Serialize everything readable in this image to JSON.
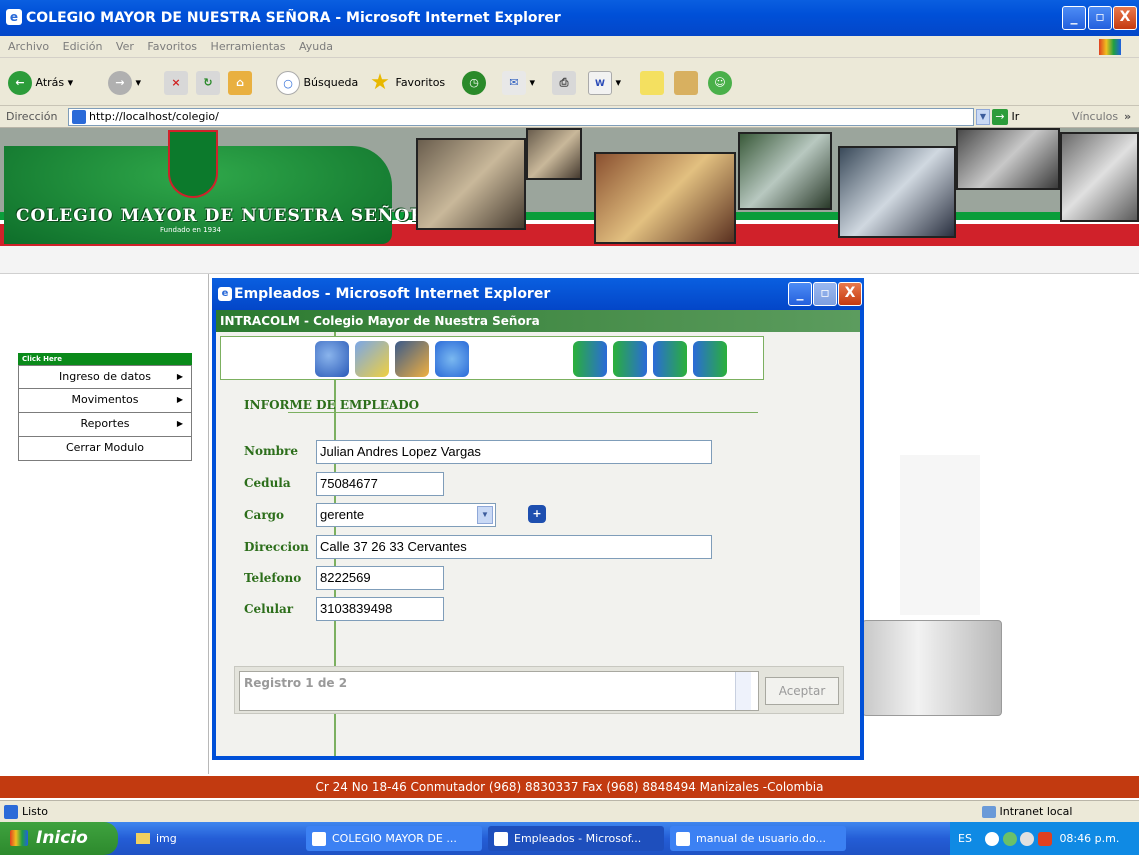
{
  "window": {
    "title": "COLEGIO MAYOR DE NUESTRA SEÑORA - Microsoft Internet Explorer",
    "minimize": "_",
    "maximize": "▫",
    "close": "X"
  },
  "menu": [
    "Archivo",
    "Edición",
    "Ver",
    "Favoritos",
    "Herramientas",
    "Ayuda"
  ],
  "toolbar": {
    "back": "Atrás",
    "search": "Búsqueda",
    "favorites": "Favoritos"
  },
  "address": {
    "label": "Dirección",
    "url": "http://localhost/colegio/",
    "go": "Ir",
    "links": "Vínculos"
  },
  "banner": {
    "name": "COLEGIO MAYOR DE NUESTRA SEÑORA",
    "founded": "Fundado en 1934"
  },
  "sidemenu": {
    "header": "Click Here",
    "items": [
      {
        "label": "Ingreso de datos",
        "arrow": "▶"
      },
      {
        "label": "Movimentos",
        "arrow": "▶"
      },
      {
        "label": "Reportes",
        "arrow": "▶"
      },
      {
        "label": "Cerrar Modulo",
        "arrow": ""
      }
    ]
  },
  "popup": {
    "title": "Empleados - Microsoft Internet Explorer",
    "header": "INTRACOLM - Colegio Mayor de Nuestra Señora",
    "section": "INFORME DE EMPLEADO",
    "fields": {
      "nombre_label": "Nombre",
      "nombre": "Julian Andres Lopez Vargas",
      "cedula_label": "Cedula",
      "cedula": "75084677",
      "cargo_label": "Cargo",
      "cargo": "gerente",
      "direccion_label": "Direccion",
      "direccion": "Calle 37 26 33 Cervantes",
      "telefono_label": "Telefono",
      "telefono": "8222569",
      "celular_label": "Celular",
      "celular": "3103839498"
    },
    "record": "Registro 1 de 2",
    "accept": "Aceptar"
  },
  "footer": "Cr 24 No 18-46 Conmutador (968) 8830337 Fax (968) 8848494 Manizales -Colombia",
  "status": {
    "left": "Listo",
    "zone": "Intranet local"
  },
  "taskbar": {
    "start": "Inicio",
    "tasks": [
      "img",
      "COLEGIO MAYOR DE ...",
      "Empleados - Microsof...",
      "manual de usuario.do..."
    ],
    "lang": "ES",
    "clock": "08:46 p.m."
  }
}
